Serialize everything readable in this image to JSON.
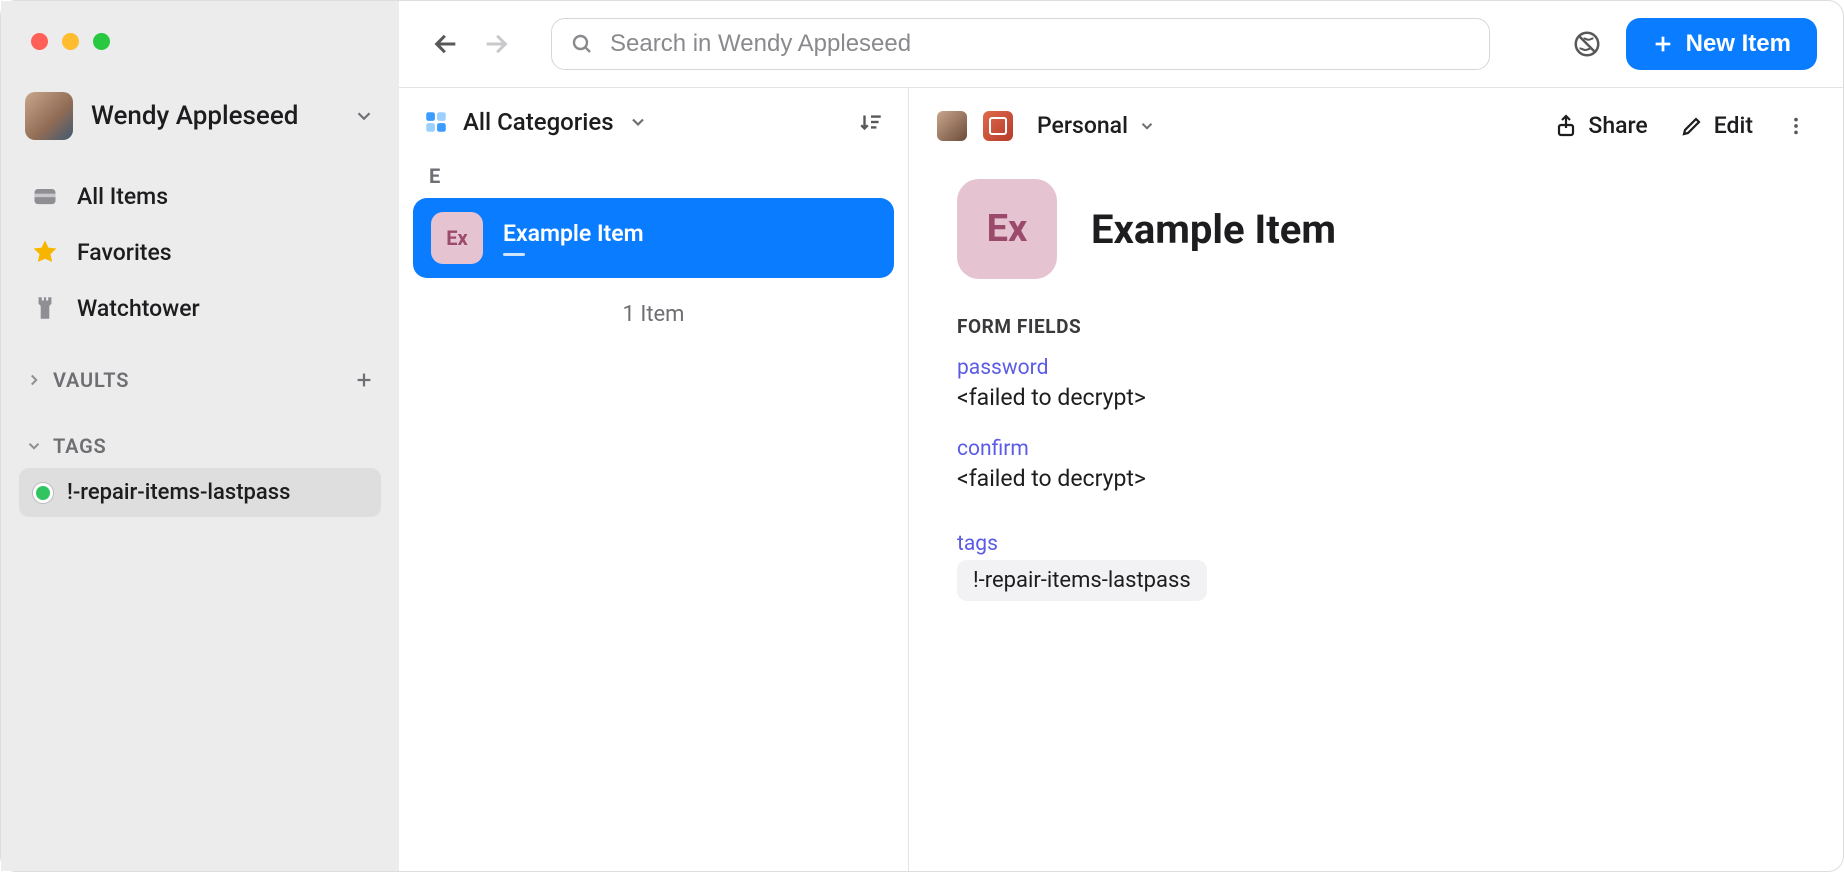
{
  "account": {
    "name": "Wendy Appleseed"
  },
  "sidebar": {
    "items": [
      {
        "icon": "wallet-icon",
        "label": "All Items"
      },
      {
        "icon": "star-icon",
        "label": "Favorites"
      },
      {
        "icon": "watchtower-icon",
        "label": "Watchtower"
      }
    ],
    "vaults_header": "VAULTS",
    "tags_header": "TAGS",
    "tags": [
      {
        "color": "#30c561",
        "label": "!-repair-items-lastpass"
      }
    ]
  },
  "header": {
    "search_placeholder": "Search in Wendy Appleseed",
    "new_item_label": "New Item"
  },
  "list": {
    "category_label": "All Categories",
    "groups": [
      {
        "letter": "E",
        "items": [
          {
            "badge": "Ex",
            "title": "Example Item",
            "selected": true
          }
        ]
      }
    ],
    "footer_count": "1 Item"
  },
  "detail": {
    "vault_label": "Personal",
    "share_label": "Share",
    "edit_label": "Edit",
    "badge": "Ex",
    "title": "Example Item",
    "form_fields_header": "FORM FIELDS",
    "fields": [
      {
        "label": "password",
        "value": "<failed to decrypt>"
      },
      {
        "label": "confirm",
        "value": "<failed to decrypt>"
      }
    ],
    "tags_label": "tags",
    "tags": [
      "!-repair-items-lastpass"
    ]
  }
}
